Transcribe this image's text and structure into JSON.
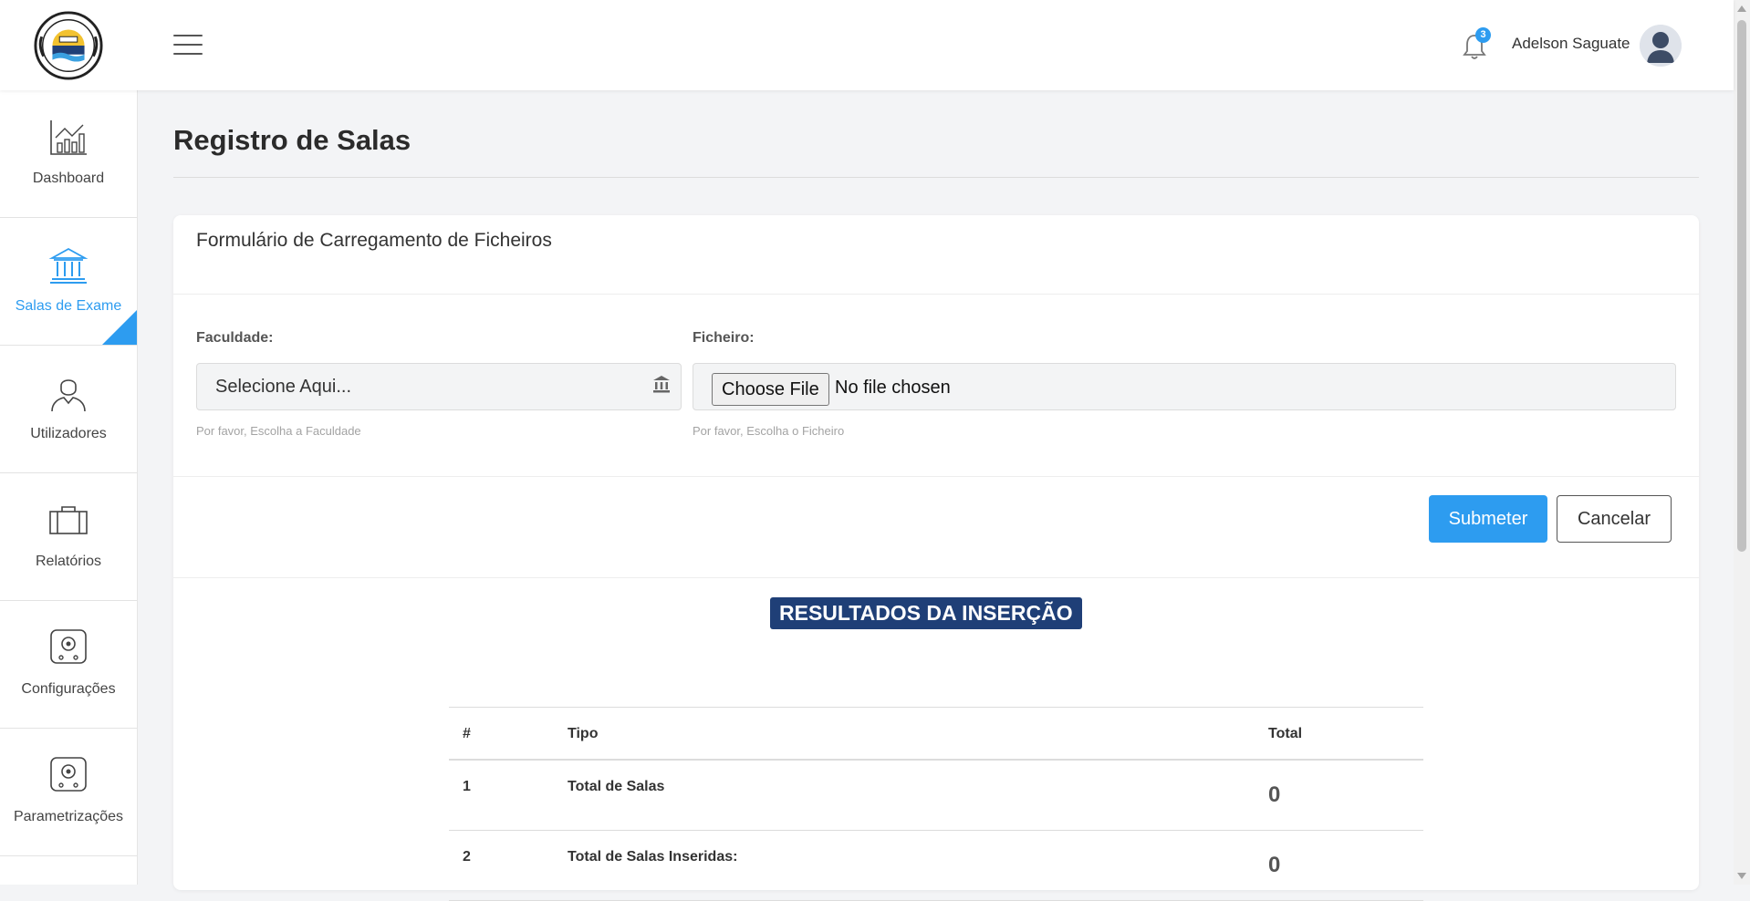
{
  "header": {
    "notification_count": "3",
    "user_name": "Adelson Saguate"
  },
  "sidebar": {
    "items": [
      {
        "label": "Dashboard",
        "icon": "chart-icon"
      },
      {
        "label": "Salas de Exame",
        "icon": "building-icon",
        "active": true
      },
      {
        "label": "Utilizadores",
        "icon": "user-icon"
      },
      {
        "label": "Relatórios",
        "icon": "briefcase-icon"
      },
      {
        "label": "Configurações",
        "icon": "safe-icon"
      },
      {
        "label": "Parametrizações",
        "icon": "safe-icon"
      }
    ]
  },
  "page": {
    "title": "Registro de Salas"
  },
  "form": {
    "title": "Formulário de Carregamento de Ficheiros",
    "faculty_label": "Faculdade:",
    "faculty_placeholder": "Selecione Aqui...",
    "faculty_hint": "Por favor, Escolha a Faculdade",
    "file_label": "Ficheiro:",
    "file_button": "Choose File",
    "file_status": "No file chosen",
    "file_hint": "Por favor, Escolha o Ficheiro",
    "submit_label": "Submeter",
    "cancel_label": "Cancelar"
  },
  "results": {
    "heading": "RESULTADOS DA INSERÇÃO",
    "columns": [
      "#",
      "Tipo",
      "Total"
    ],
    "rows": [
      {
        "n": "1",
        "tipo": "Total de Salas",
        "total": "0"
      },
      {
        "n": "2",
        "tipo": "Total de Salas Inseridas:",
        "total": "0"
      }
    ]
  },
  "colors": {
    "accent": "#2d9cf0",
    "results_badge": "#1f3f77"
  }
}
